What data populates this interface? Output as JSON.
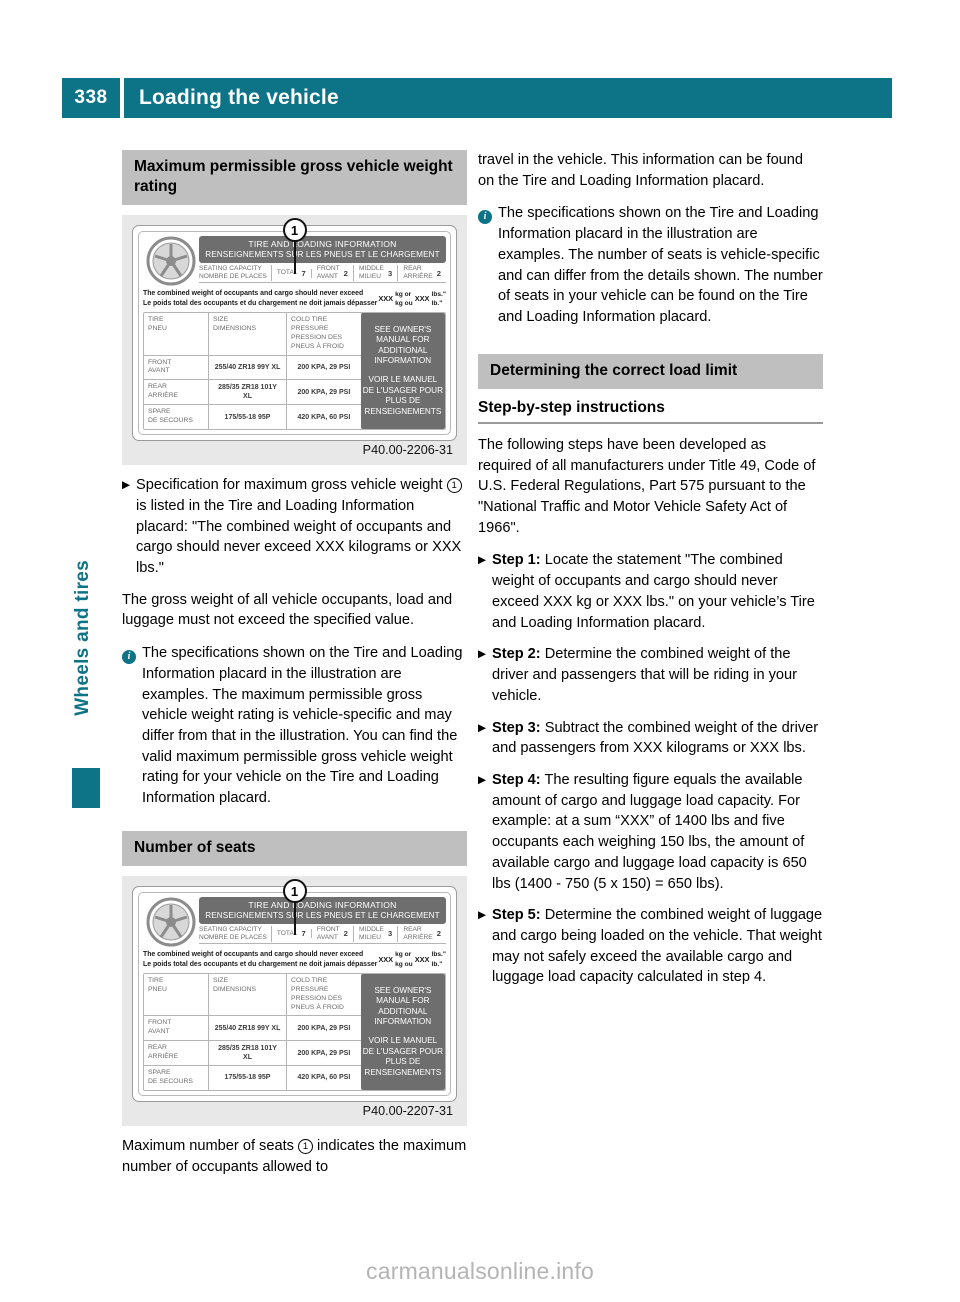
{
  "header": {
    "page_number": "338",
    "title": "Loading the vehicle"
  },
  "side_tab": {
    "label": "Wheels and tires"
  },
  "watermark": "carmanualsonline.info",
  "left_column": {
    "section_heading_1": "Maximum permissible gross vehicle weight rating",
    "figure_1_caption": "P40.00-2206-31",
    "bullet_1": {
      "marker": "▶",
      "text_before": "Specification for maximum gross vehicle weight ",
      "callout": "1",
      "text_after": " is listed in the Tire and Loading Information placard: \"The combined weight of occupants and cargo should never exceed XXX kilograms or XXX lbs.\""
    },
    "paragraph_1": "The gross weight of all vehicle occupants, load and luggage must not exceed the specified value.",
    "note_1": "The specifications shown on the Tire and Loading Information placard in the illustration are examples. The maximum permissible gross vehicle weight rating is vehicle-specific and may differ from that in the illustration. You can find the valid maximum permissible gross vehicle weight rating for your vehicle on the Tire and Loading Information placard.",
    "section_heading_2": "Number of seats",
    "figure_2_caption": "P40.00-2207-31",
    "paragraph_2_before": "Maximum number of seats ",
    "paragraph_2_callout": "1",
    "paragraph_2_after": " indicates the maximum number of occupants allowed to"
  },
  "right_column": {
    "paragraph_1": "travel in the vehicle. This information can be found on the Tire and Loading Information placard.",
    "note_1": "The specifications shown on the Tire and Loading Information placard in the illustration are examples. The number of seats is vehicle-specific and can differ from the details shown. The number of seats in your vehicle can be found on the Tire and Loading Information placard.",
    "section_heading_1": "Determining the correct load limit",
    "sub_heading_1": "Step-by-step instructions",
    "paragraph_2": "The following steps have been developed as required of all manufacturers under Title 49, Code of U.S. Federal Regulations, Part 575 pursuant to the \"National Traffic and Motor Vehicle Safety Act of 1966\".",
    "steps": [
      {
        "marker": "▶",
        "label": "Step 1:",
        "text": " Locate the statement \"The combined weight of occupants and cargo should never exceed XXX kg or XXX lbs.\" on your vehicle’s Tire and Loading Information placard."
      },
      {
        "marker": "▶",
        "label": "Step 2:",
        "text": " Determine the combined weight of the driver and passengers that will be riding in your vehicle."
      },
      {
        "marker": "▶",
        "label": "Step 3:",
        "text": " Subtract the combined weight of the driver and passengers from XXX kilograms or XXX lbs."
      },
      {
        "marker": "▶",
        "label": "Step 4:",
        "text": " The resulting figure equals the available amount of cargo and luggage load capacity. For example: at a sum “XXX” of 1400 lbs and five occupants each weighing 150 lbs, the amount of available cargo and luggage load capacity is 650 lbs (1400 - 750 (5 x 150) = 650 lbs)."
      },
      {
        "marker": "▶",
        "label": "Step 5:",
        "text": " Determine the combined weight of luggage and cargo being loaded on the vehicle. That weight may not safely exceed the available cargo and luggage load capacity calculated in step 4."
      }
    ]
  },
  "placard": {
    "callout": "1",
    "band_line_1": "TIRE AND LOADING INFORMATION",
    "band_line_2": "RENSEIGNEMENTS SUR LES PNEUS ET LE CHARGEMENT",
    "seating_label_1": "SEATING CAPACITY",
    "seating_label_2": "NOMBRE DE PLACES",
    "seating_cells": [
      {
        "label": "TOTAL",
        "value": "7"
      },
      {
        "label": "FRONT\nAVANT",
        "value": "2"
      },
      {
        "label": "MIDDLE\nMILIEU",
        "value": "3"
      },
      {
        "label": "REAR\nARRIÈRE",
        "value": "2"
      }
    ],
    "combined_line_1": "The combined weight of occupants and cargo should never exceed",
    "combined_line_2": "Le poids total des occupants et du chargement ne doit jamais dépasser",
    "combined_value_1": "XXX",
    "combined_unit_1a": "kg or",
    "combined_unit_1b": "kg ou",
    "combined_value_2": "XXX",
    "combined_unit_2a": "lbs.\"",
    "combined_unit_2b": "lb.\"",
    "table_header": {
      "c1": "TIRE\nPNEU",
      "c2": "SIZE\nDIMENSIONS",
      "c3": "COLD TIRE PRESSURE\nPRESSION DES\nPNEUS À FROID"
    },
    "table_rows": [
      {
        "c1": "FRONT\nAVANT",
        "c2": "255/40 ZR18 99Y XL",
        "c3": "200 KPA, 29 PSI"
      },
      {
        "c1": "REAR\nARRIÈRE",
        "c2": "285/35 ZR18 101Y XL",
        "c3": "200 KPA, 29 PSI"
      },
      {
        "c1": "SPARE\nDE SECOURS",
        "c2": "175/55-18 95P",
        "c3": "420 KPA, 60 PSI"
      }
    ],
    "side_panel_en": "SEE OWNER'S MANUAL FOR ADDITIONAL INFORMATION",
    "side_panel_fr": "VOIR LE MANUEL DE L'USAGER POUR PLUS DE RENSEIGNEMENTS"
  },
  "colors": {
    "teal": "#0d7387",
    "heading_gray": "#bfbfbf",
    "figure_bg": "#e8e8e8",
    "placard_dark": "#6e6e6e"
  }
}
